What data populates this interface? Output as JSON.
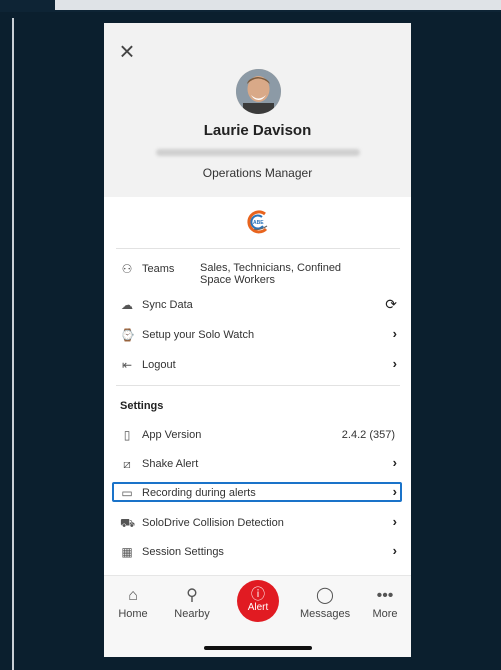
{
  "profile": {
    "name": "Laurie Davison",
    "role": "Operations Manager"
  },
  "menu": {
    "teams_label": "Teams",
    "teams_value": "Sales, Technicians, Confined Space Workers",
    "sync_label": "Sync Data",
    "watch_label": "Setup your Solo Watch",
    "logout_label": "Logout"
  },
  "settings": {
    "title": "Settings",
    "app_version_label": "App Version",
    "app_version_value": "2.4.2 (357)",
    "shake_alert_label": "Shake Alert",
    "recording_label": "Recording during alerts",
    "solodrive_label": "SoloDrive Collision Detection",
    "session_label": "Session Settings"
  },
  "tabs": {
    "home": "Home",
    "nearby": "Nearby",
    "alert": "Alert",
    "messages": "Messages",
    "more": "More"
  },
  "colors": {
    "accent": "#1a73c9",
    "alert": "#e11b22"
  }
}
